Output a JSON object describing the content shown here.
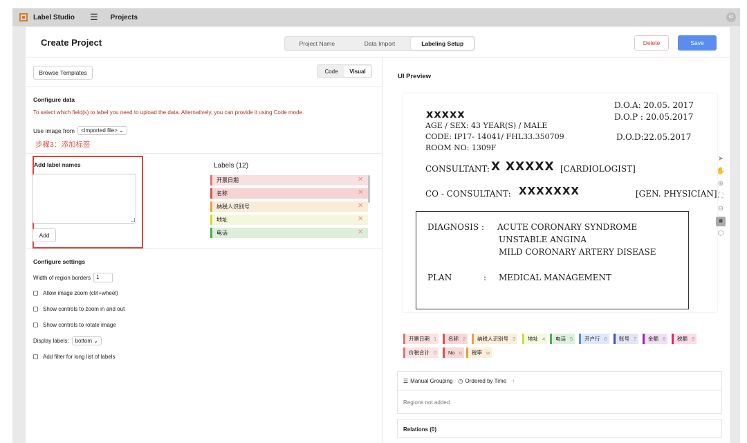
{
  "topbar": {
    "app_name": "Label Studio",
    "nav_projects": "Projects",
    "avatar_initials": "62"
  },
  "header": {
    "title": "Create Project",
    "tabs": [
      {
        "label": "Project Name",
        "active": false
      },
      {
        "label": "Data Import",
        "active": false
      },
      {
        "label": "Labeling Setup",
        "active": true
      }
    ],
    "delete_label": "Delete",
    "save_label": "Save"
  },
  "left": {
    "browse_templates": "Browse Templates",
    "view_toggle": {
      "code": "Code",
      "visual": "Visual",
      "selected": "Visual"
    },
    "configure_data": "Configure data",
    "warning": "To select which field(s) to label you need to upload the data. Alternatively, you can provide it using Code mode.",
    "use_image_from_label": "Use image from",
    "use_image_from_value": "<imported file>",
    "step_annotation": "步骤3：添加标签",
    "add_label_names": "Add label names",
    "add_button": "Add",
    "labels_header": "Labels (12)",
    "label_list": [
      {
        "name": "开票日期",
        "color": "#e57373",
        "bg": "#f7e0e0"
      },
      {
        "name": "名称",
        "color": "#d9534f",
        "bg": "#f6d3d3"
      },
      {
        "name": "纳税人识别号",
        "color": "#e8a33d",
        "bg": "#f8ecd8"
      },
      {
        "name": "地址",
        "color": "#cddc39",
        "bg": "#f4f7dc"
      },
      {
        "name": "电话",
        "color": "#4caf50",
        "bg": "#dcefdc"
      }
    ],
    "configure_settings": "Configure settings",
    "settings": {
      "width_label": "Width of region borders",
      "width_value": "1",
      "allow_zoom": "Allow image zoom (ctrl+wheel)",
      "show_zoom_controls": "Show controls to zoom in and out",
      "show_rotate_controls": "Show controls to rotate image",
      "display_labels_label": "Display labels:",
      "display_labels_value": "bottom",
      "add_filter": "Add filter for long list of labels"
    }
  },
  "right": {
    "ui_preview": "UI Preview",
    "document": {
      "doa": "D.O.A: 20.05. 2017",
      "dop": "D.O.P : 20.05.2017",
      "name": "xxxxx",
      "age_sex": "AGE / SEX: 43 YEAR(S) / MALE",
      "code": "CODE: IP17- 14041/ FHL33.350709",
      "dod": "D.O.D:22.05.2017",
      "room": "ROOM NO: 1309F",
      "consultant_label": "CONSULTANT:",
      "consultant_name": "X XXXXX",
      "consultant_role": "[CARDIOLOGIST]",
      "co_consultant_label": "CO - CONSULTANT:",
      "co_consultant_name": "XXXXXXX",
      "co_consultant_role": "[GEN. PHYSICIAN]",
      "diagnosis_label": "DIAGNOSIS :",
      "diagnosis_1": "ACUTE CORONARY SYNDROME",
      "diagnosis_2": "UNSTABLE ANGINA",
      "diagnosis_3": "MILD CORONARY ARTERY DISEASE",
      "plan_label": "PLAN",
      "plan_colon": ":",
      "plan_value": "MEDICAL MANAGEMENT"
    },
    "tools": [
      "arrow-icon",
      "hand-icon",
      "zoom-in-icon",
      "fit-icon",
      "zoom-out-icon",
      "rect-icon",
      "polygon-icon"
    ],
    "tags": [
      {
        "name": "开票日期",
        "key": "1",
        "color": "#e57373",
        "bg": "#fbe3e3"
      },
      {
        "name": "名称",
        "key": "2",
        "color": "#d9534f",
        "bg": "#f8d7d7"
      },
      {
        "name": "纳税人识别号",
        "key": "3",
        "color": "#e8a33d",
        "bg": "#fbeedb"
      },
      {
        "name": "地址",
        "key": "4",
        "color": "#cddc39",
        "bg": "#f6f9de"
      },
      {
        "name": "电话",
        "key": "5",
        "color": "#4caf50",
        "bg": "#def0de"
      },
      {
        "name": "开户行",
        "key": "6",
        "color": "#5b8dee",
        "bg": "#e0e9fb"
      },
      {
        "name": "账号",
        "key": "7",
        "color": "#3f51b5",
        "bg": "#e3e5f4"
      },
      {
        "name": "金额",
        "key": "8",
        "color": "#9c27b0",
        "bg": "#f0dff3"
      },
      {
        "name": "税额",
        "key": "9",
        "color": "#e91e63",
        "bg": "#fbdce7"
      },
      {
        "name": "价税合计",
        "key": "0",
        "color": "#e57373",
        "bg": "#fbe3e3"
      },
      {
        "name": "No",
        "key": "q",
        "color": "#d9534f",
        "bg": "#f8d7d7"
      },
      {
        "name": "税率",
        "key": "w",
        "color": "#e8a33d",
        "bg": "#fbeedb"
      }
    ],
    "manual_grouping": "Manual Grouping",
    "ordered_by_time": "Ordered by Time",
    "regions_empty": "Regions not added",
    "relations": "Relations (0)"
  }
}
